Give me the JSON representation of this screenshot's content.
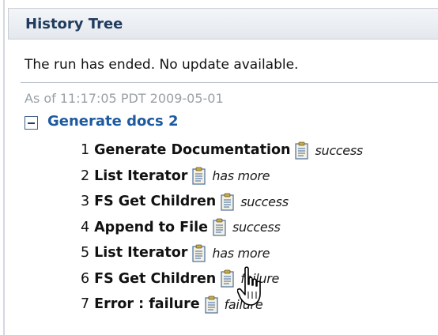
{
  "panel": {
    "title": "History Tree",
    "message": "The run has ended. No update available."
  },
  "run": {
    "timestamp": "As of 11:17:05 PDT 2009-05-01",
    "name": "Generate docs 2",
    "expanded": true,
    "steps": [
      {
        "number": "1",
        "name": "Generate Documentation",
        "status": "success"
      },
      {
        "number": "2",
        "name": "List Iterator",
        "status": "has more"
      },
      {
        "number": "3",
        "name": "FS Get Children",
        "status": "success"
      },
      {
        "number": "4",
        "name": "Append to File",
        "status": "success"
      },
      {
        "number": "5",
        "name": "List Iterator",
        "status": "has more"
      },
      {
        "number": "6",
        "name": "FS Get Children",
        "status": "failure"
      },
      {
        "number": "7",
        "name": "Error : failure",
        "status": "failure"
      }
    ]
  },
  "icons": {
    "step_detail": "document-icon",
    "toggle": "collapse-minus-icon",
    "pointer": "hand-pointer-icon"
  },
  "colors": {
    "header_text": "#1f3b5e",
    "tree_root": "#1d5aa0",
    "timestamp": "#9aa0a6",
    "header_bg": "#e4e8ee"
  }
}
